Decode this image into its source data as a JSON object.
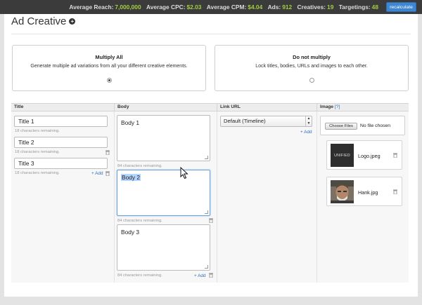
{
  "topbar": {
    "stats": [
      {
        "label": "Average Reach:",
        "value": "7,000,000"
      },
      {
        "label": "Average CPC:",
        "value": "$2.03"
      },
      {
        "label": "Average CPM:",
        "value": "$4.04"
      },
      {
        "label": "Ads:",
        "value": "912"
      },
      {
        "label": "Creatives:",
        "value": "19"
      },
      {
        "label": "Targetings:",
        "value": "48"
      }
    ],
    "recalculate_label": "recalculate"
  },
  "page": {
    "title": "Ad Creative"
  },
  "modes": {
    "multiply_all": {
      "title": "Multiply All",
      "description": "Generate multiple ad variations from all your different creative elements.",
      "selected": true
    },
    "do_not_multiply": {
      "title": "Do not multiply",
      "description": "Lock titles, bodies, URLs and images to each other.",
      "selected": false
    }
  },
  "columns": {
    "title": "Title",
    "body": "Body",
    "link_url": "Link URL",
    "image": "Image",
    "image_help": "[?]"
  },
  "titles": [
    {
      "value": "Title 1",
      "remaining": "18 characters remaining."
    },
    {
      "value": "Title 2",
      "remaining": "18 characters remaining."
    },
    {
      "value": "Title 3",
      "remaining": "18 characters remaining."
    }
  ],
  "bodies": [
    {
      "value": "Body 1",
      "remaining": "84 characters remaining."
    },
    {
      "value": "Body 2",
      "remaining": "84 characters remaining."
    },
    {
      "value": "Body 3",
      "remaining": "84 characters remaining."
    }
  ],
  "add_label": "+ Add",
  "link_url": {
    "selected": "Default (Timeline)"
  },
  "image_upload": {
    "button_label": "Choose Files",
    "status": "No file chosen"
  },
  "images": [
    {
      "name": "Logo.jpeg",
      "thumb_text": "UNIFIED"
    },
    {
      "name": "Hank.jpg"
    }
  ],
  "colors": {
    "stat_value": "#a2cd3f",
    "accent": "#3d86d1",
    "link": "#2f6fb6",
    "selection": "#b4d5fe"
  },
  "icons": [
    "plus-circle-icon",
    "trash-icon",
    "select-arrows-icon",
    "mouse-cursor-icon"
  ]
}
